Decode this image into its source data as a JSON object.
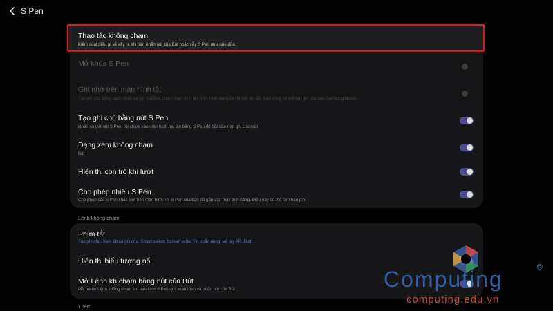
{
  "header": {
    "title": "S Pen"
  },
  "highlight": {
    "title": "Thao tác không chạm",
    "desc": "Kiểm soát điều gì sẽ xảy ra khi bạn nhấn nút của Bút hoặc vẫy S Pen như que đũa."
  },
  "settings": [
    {
      "title": "Mở khóa S Pen",
      "desc": "",
      "toggle": "off",
      "dimmed": true
    },
    {
      "title": "Ghi nhớ trên màn hình tắt",
      "desc": "Tạo ghi chú bằng cách nhấn và giữ nút Bút, chạm màn hình khi màn hình đang tắt rồi viết lên đó. Bạn cũng có thể lưu ghi chú vào Samsung Notes.",
      "toggle": "off",
      "dimmed": true
    },
    {
      "title": "Tạo ghi chú bằng nút S Pen",
      "desc": "Nhấn và giữ nút S Pen, rồi chạm vào màn hình hai lần bằng S Pen để bắt đầu một ghi chú mới",
      "toggle": "on",
      "dimmed": false
    },
    {
      "title": "Dạng xem không chạm",
      "desc": "Bật",
      "toggle": "on",
      "dimmed": false
    },
    {
      "title": "Hiển thị con trỏ khi lướt",
      "desc": "",
      "toggle": "on",
      "dimmed": false
    },
    {
      "title": "Cho phép nhiều S Pen",
      "desc": "Cho phép các S Pen khác viết trên màn hình khi S Pen của bạn đã gắn vào máy tính bảng. Điều này có thể làm hao pin",
      "toggle": "on",
      "dimmed": false
    }
  ],
  "section_air_command": "Lệnh không chạm",
  "air_command": [
    {
      "title": "Phím tắt",
      "desc": "Tạo ghi chú, Xem tất cả ghi chú, Smart select, Screen write, Tin nhắn động, Vẽ tay AR, Dịch",
      "toggle": "none",
      "link": true
    },
    {
      "title": "Hiển thị biểu tượng nổi",
      "desc": "",
      "toggle": "on",
      "link": false
    },
    {
      "title": "Mở Lệnh kh.chạm bằng nút của Bút",
      "desc": "Mở menu Lệnh không chạm khi bạn lướt S Pen qua màn hình và nhấn nút của Bút",
      "toggle": "on",
      "link": false
    }
  ],
  "section_more": "Thêm",
  "watermark": {
    "brand": "Computing",
    "url": "computing.edu.vn",
    "reg": "®"
  },
  "colors": {
    "accent_toggle": "#4d4a8e",
    "highlight_border": "#e1141b",
    "link": "#4f76c6"
  }
}
